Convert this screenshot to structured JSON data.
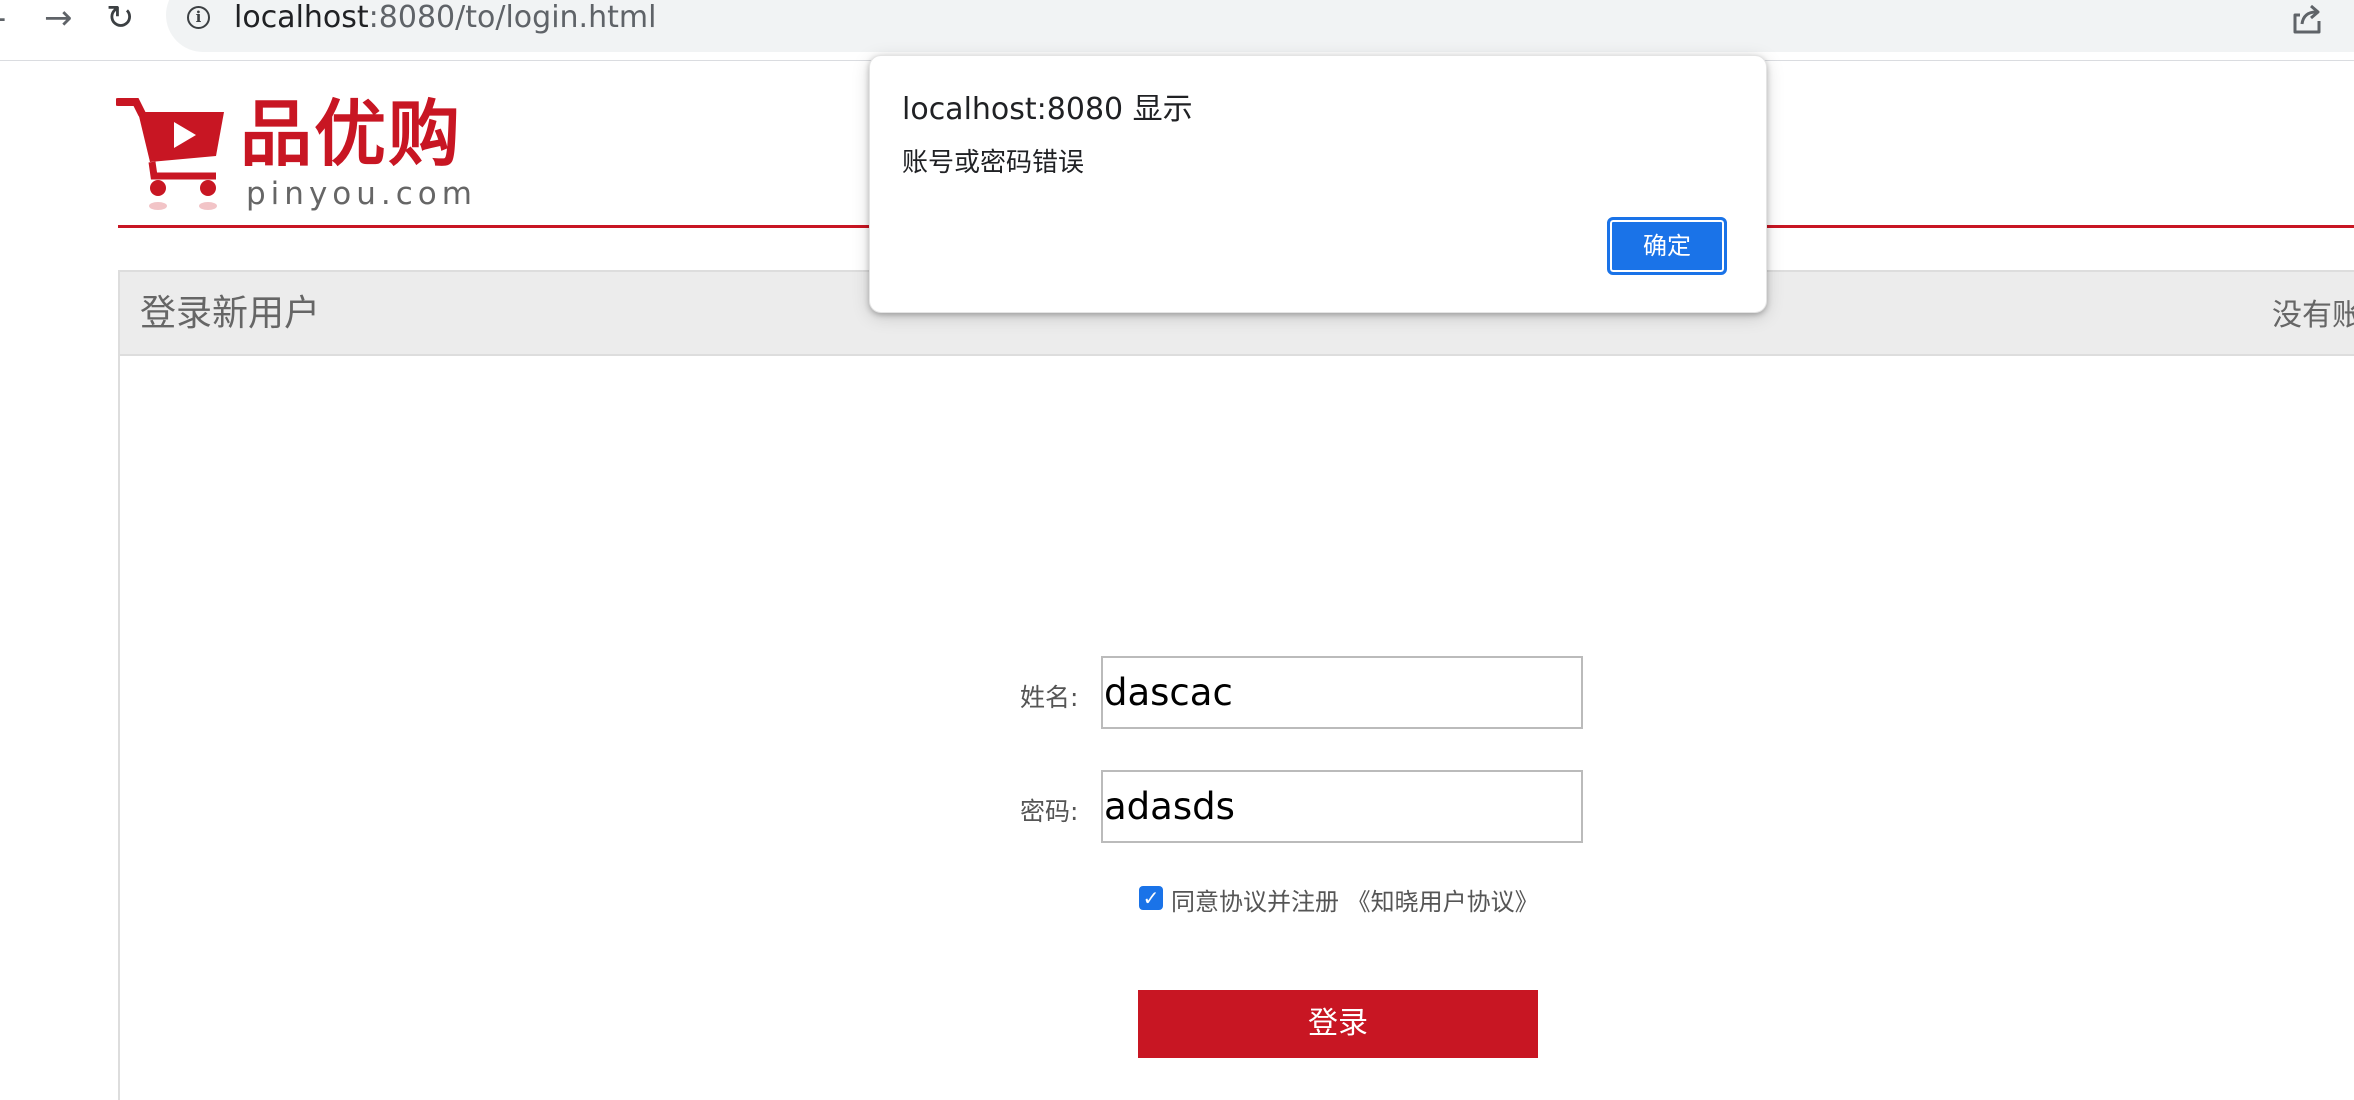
{
  "browser": {
    "back_glyph": "-",
    "forward_glyph": "→",
    "reload_glyph": "↻",
    "info_glyph": "i",
    "url_host": "localhost",
    "url_rest": ":8080/to/login.html"
  },
  "logo": {
    "name_cn": "品优购",
    "domain": "pinyou.com"
  },
  "panel": {
    "title": "登录新用户",
    "right_text": "没有账"
  },
  "form": {
    "name_label": "姓名:",
    "name_value": "dascac",
    "password_label": "密码:",
    "password_value": "adasds",
    "agree_checked": true,
    "agree_text": "同意协议并注册 《知晓用户协议》",
    "login_button": "登录"
  },
  "alert": {
    "title": "localhost:8080 显示",
    "message": "账号或密码错误",
    "ok_button": "确定"
  },
  "colors": {
    "brand_red": "#c81623",
    "alert_blue": "#1a73e8"
  }
}
